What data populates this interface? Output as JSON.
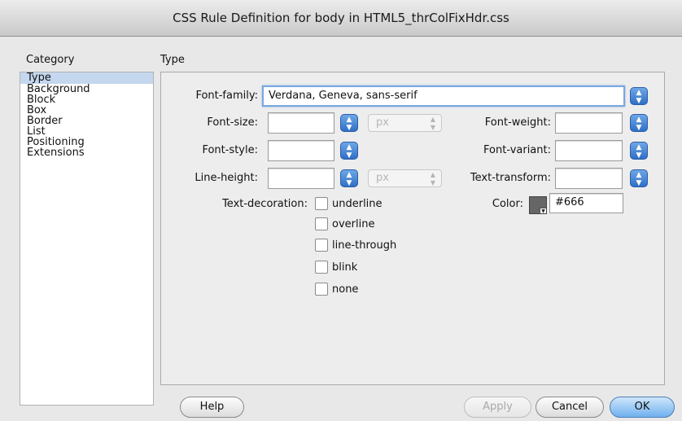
{
  "window": {
    "title": "CSS Rule Definition for body in HTML5_thrColFixHdr.css"
  },
  "category": {
    "heading": "Category",
    "items": [
      "Type",
      "Background",
      "Block",
      "Box",
      "Border",
      "List",
      "Positioning",
      "Extensions"
    ],
    "selected": "Type"
  },
  "panel": {
    "heading": "Type",
    "font_family": {
      "label": "Font-family:",
      "value": "Verdana, Geneva, sans-serif"
    },
    "font_size": {
      "label": "Font-size:",
      "value": "",
      "unit": "px"
    },
    "font_weight": {
      "label": "Font-weight:",
      "value": ""
    },
    "font_style": {
      "label": "Font-style:",
      "value": ""
    },
    "font_variant": {
      "label": "Font-variant:",
      "value": ""
    },
    "line_height": {
      "label": "Line-height:",
      "value": "",
      "unit": "px"
    },
    "text_transform": {
      "label": "Text-transform:",
      "value": ""
    },
    "text_decoration": {
      "label": "Text-decoration:",
      "options": [
        "underline",
        "overline",
        "line-through",
        "blink",
        "none"
      ]
    },
    "color": {
      "label": "Color:",
      "value": "#666",
      "swatch": "#666666"
    }
  },
  "buttons": {
    "help": "Help",
    "apply": "Apply",
    "cancel": "Cancel",
    "ok": "OK"
  }
}
